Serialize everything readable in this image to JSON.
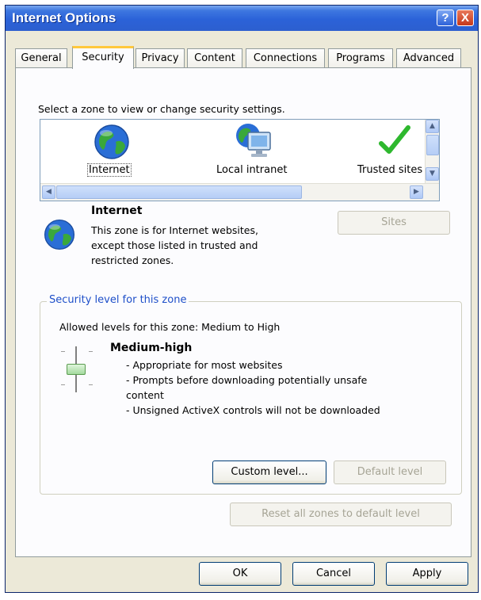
{
  "window": {
    "title": "Internet Options",
    "help_glyph": "?",
    "close_glyph": "X"
  },
  "tabs": [
    {
      "label": "General"
    },
    {
      "label": "Security",
      "active": true
    },
    {
      "label": "Privacy"
    },
    {
      "label": "Content"
    },
    {
      "label": "Connections"
    },
    {
      "label": "Programs"
    },
    {
      "label": "Advanced"
    }
  ],
  "security": {
    "instruction": "Select a zone to view or change security settings.",
    "zones": [
      {
        "label": "Internet",
        "icon": "globe-icon",
        "selected": true
      },
      {
        "label": "Local intranet",
        "icon": "computer-network-icon"
      },
      {
        "label": "Trusted sites",
        "icon": "checkmark-icon"
      }
    ],
    "selected_zone": {
      "name": "Internet",
      "description_lines": [
        "This zone is for Internet websites,",
        "except those listed in trusted and",
        "restricted zones."
      ]
    },
    "sites_button": "Sites",
    "group_title": "Security level for this zone",
    "allowed_levels": "Allowed levels for this zone: Medium to High",
    "level_name": "Medium-high",
    "level_bullets": [
      "- Appropriate for most websites",
      "- Prompts before downloading potentially unsafe",
      "content",
      "- Unsigned ActiveX controls will not be downloaded"
    ],
    "custom_level_button": "Custom level...",
    "default_level_button": "Default level",
    "reset_all_button": "Reset all zones to default level"
  },
  "footer": {
    "ok": "OK",
    "cancel": "Cancel",
    "apply": "Apply"
  },
  "colors": {
    "titlebar": "#2b62d8",
    "dialog_bg": "#ece9d8",
    "active_tab_accent": "#ffc83c",
    "group_title": "#1e4fc9",
    "trusted_check": "#2eb82e"
  }
}
